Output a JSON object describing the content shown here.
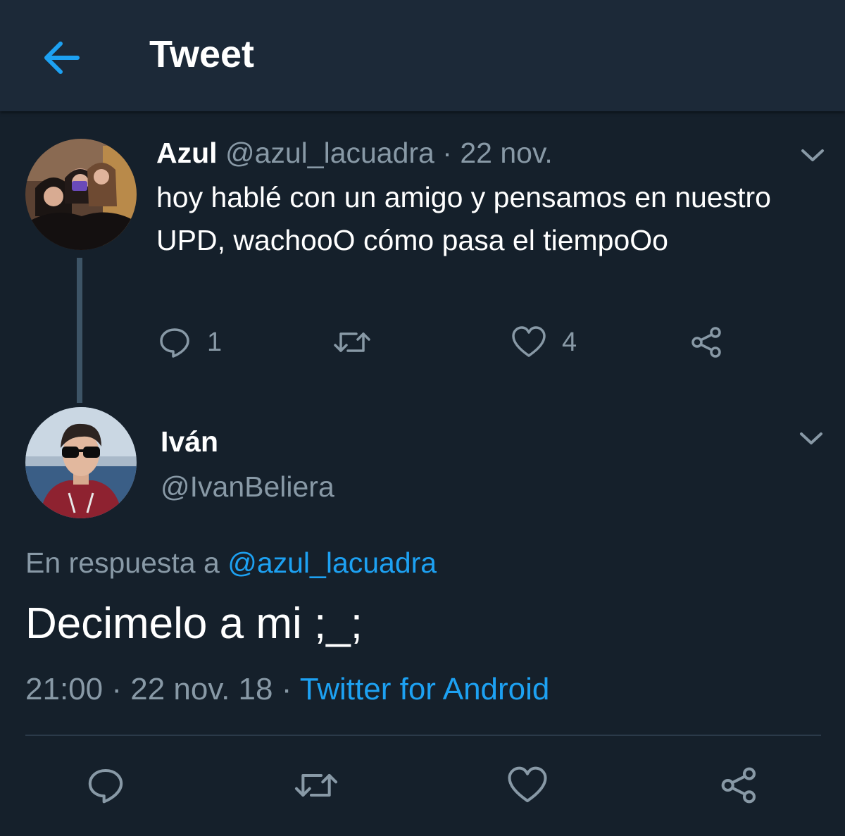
{
  "header": {
    "title": "Tweet",
    "back_icon": "arrow-left-icon",
    "accent_color": "#1da1f2"
  },
  "parent_tweet": {
    "author_name": "Azul",
    "author_handle": "@azul_lacuadra",
    "separator": "·",
    "date": "22 nov.",
    "text": "hoy hablé con un amigo y pensamos en nuestro UPD, wachooO cómo pasa el tiempoOo",
    "actions": {
      "reply_count": "1",
      "like_count": "4"
    }
  },
  "main_tweet": {
    "author_name": "Iván",
    "author_handle": "@IvanBeliera",
    "reply_prefix": "En respuesta a",
    "reply_handle": "@azul_lacuadra",
    "text": "Decimelo a mi ;_;",
    "time": "21:00",
    "separator": "·",
    "date": "22 nov. 18",
    "source": "Twitter for Android"
  },
  "icons": [
    "reply-icon",
    "retweet-icon",
    "like-icon",
    "share-icon",
    "chevron-down-icon"
  ],
  "colors": {
    "background": "#15202b",
    "header": "#1c2938",
    "muted_text": "#8899a6",
    "link": "#1da1f2"
  }
}
